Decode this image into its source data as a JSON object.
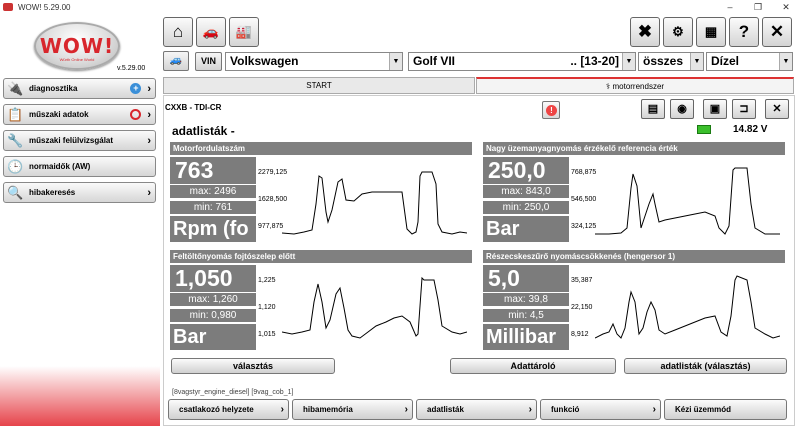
{
  "window": {
    "title": "WOW! 5.29.00",
    "minimize": "–",
    "maximize": "❐",
    "close": "✕"
  },
  "logo": {
    "brand": "WOW!",
    "tagline": "Würth Online World"
  },
  "version": "v.5.29.00",
  "sidebar": {
    "items": [
      {
        "label": "diagnosztika",
        "icon": "diagnostics-icon"
      },
      {
        "label": "műszaki adatok",
        "icon": "technical-data-icon"
      },
      {
        "label": "műszaki felülvizsgálat",
        "icon": "wrench-icon"
      },
      {
        "label": "normaidők (AW)",
        "icon": "clock-icon"
      },
      {
        "label": "hibakeresés",
        "icon": "troubleshoot-icon"
      }
    ]
  },
  "vehicle": {
    "vin_label": "VIN",
    "make": "Volkswagen",
    "model": "Golf VII",
    "years": ".. [13-20]",
    "variant": "összes",
    "fuel": "Dízel"
  },
  "tabs": {
    "start": "START",
    "system": "motorrendszer"
  },
  "panel": {
    "ecu": "CXXB - TDI-CR",
    "title": "adatlisták -",
    "voltage": "14.82 V"
  },
  "gauges": [
    {
      "title": "Motorfordulatszám",
      "value": "763",
      "max": "max: 2496",
      "min": "min: 761",
      "unit": "Rpm (fo",
      "axis": [
        "2279,125",
        "1628,500",
        "977,875"
      ]
    },
    {
      "title": "Nagy üzemanyagnyomás érzékelő referencia érték",
      "value": "250,0",
      "max": "max: 843,0",
      "min": "min: 250,0",
      "unit": "Bar",
      "axis": [
        "768,875",
        "546,500",
        "324,125"
      ]
    },
    {
      "title": "Feltöltőnyomás fojtószelep előtt",
      "value": "1,050",
      "max": "max: 1,260",
      "min": "min: 0,980",
      "unit": "Bar",
      "axis": [
        "1,225",
        "1,120",
        "1,015"
      ]
    },
    {
      "title": "Részecskeszűrő nyomáscsökkenés (hengersor 1)",
      "value": "5,0",
      "max": "max: 39,8",
      "min": "min: 4,5",
      "unit": "Millibar",
      "axis": [
        "35,387",
        "22,150",
        "8,912"
      ]
    }
  ],
  "buttons": {
    "select": "választás",
    "datastore": "Adattároló",
    "datalists_select": "adatlisták (választás)"
  },
  "scripts_line": "[8vagstyr_engine_diesel] [9vag_cob_1]",
  "bottom": [
    {
      "label": "csatlakozó helyzete",
      "arrow": "›"
    },
    {
      "label": "hibamemória",
      "arrow": "›"
    },
    {
      "label": "adatlisták",
      "arrow": "›"
    },
    {
      "label": "funkció",
      "arrow": "›"
    },
    {
      "label": "Kézi üzemmód",
      "arrow": ""
    }
  ]
}
